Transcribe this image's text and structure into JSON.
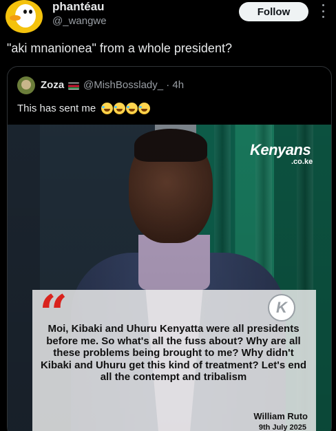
{
  "post": {
    "author_name": "phantéau",
    "author_handle": "@_wangwe",
    "follow_label": "Follow",
    "text": "\"aki mnanionea\" from a whole president?"
  },
  "quote": {
    "author_name": "Zoza",
    "author_handle": "@MishBosslady_ · 4h",
    "text": "This has sent me",
    "emoji_count": 4
  },
  "image": {
    "brand": "Kenyans",
    "brand_sub": ".co.ke",
    "quote_text": "Moi, Kibaki and Uhuru Kenyatta were all presidents before me. So what's all the fuss about? Why are all these problems being brought to me? Why didn't Kibaki and Uhuru get this kind of treatment? Let's end all the contempt and tribalism",
    "quote_author": "William Ruto",
    "quote_date": "9th July 2025",
    "logo_letter": "K"
  }
}
